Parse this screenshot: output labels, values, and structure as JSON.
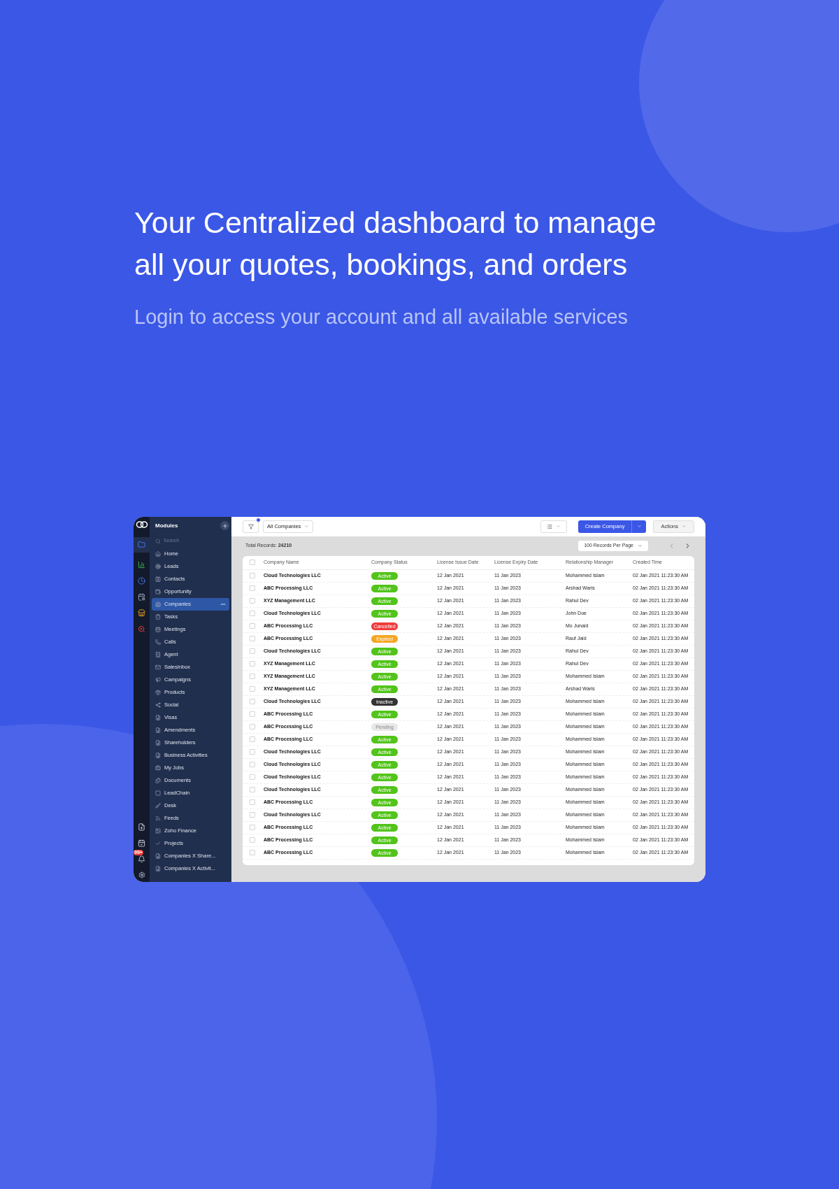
{
  "hero": {
    "title_lines": [
      "Your Centralized dashboard to manage",
      "all your quotes, bookings, and orders"
    ],
    "subtitle": "Login to access your account and all available services"
  },
  "app": {
    "rail": {
      "notification_badge": "99+"
    },
    "sidebar": {
      "title": "Modules",
      "search": {
        "placeholder": "Search"
      },
      "items": [
        {
          "label": "Home",
          "selected": false
        },
        {
          "label": "Leads",
          "selected": false
        },
        {
          "label": "Contacts",
          "selected": false
        },
        {
          "label": "Opportunity",
          "selected": false
        },
        {
          "label": "Companies",
          "selected": true
        },
        {
          "label": "Tasks",
          "selected": false
        },
        {
          "label": "Meetings",
          "selected": false
        },
        {
          "label": "Calls",
          "selected": false
        },
        {
          "label": "Agent",
          "selected": false
        },
        {
          "label": "SalesInbox",
          "selected": false
        },
        {
          "label": "Campaigns",
          "selected": false
        },
        {
          "label": "Products",
          "selected": false
        },
        {
          "label": "Social",
          "selected": false
        },
        {
          "label": "Visas",
          "selected": false
        },
        {
          "label": "Amendments",
          "selected": false
        },
        {
          "label": "Shareholders",
          "selected": false
        },
        {
          "label": "Business Activities",
          "selected": false
        },
        {
          "label": "My Jobs",
          "selected": false
        },
        {
          "label": "Documents",
          "selected": false
        },
        {
          "label": "LeadChain",
          "selected": false
        },
        {
          "label": "Desk",
          "selected": false
        },
        {
          "label": "Feeds",
          "selected": false
        },
        {
          "label": "Zoho Finance",
          "selected": false
        },
        {
          "label": "Projects",
          "selected": false
        },
        {
          "label": "Companies X Share...",
          "selected": false
        },
        {
          "label": "Companies X Activit...",
          "selected": false
        }
      ]
    },
    "toolbar": {
      "view": "All Companies",
      "create_button": "Create Company",
      "actions_button": "Actions"
    },
    "summary": {
      "label": "Total Records:",
      "count": "24210"
    },
    "per_page": "100 Records Per Page",
    "table": {
      "all_checked": false,
      "columns": [
        "Company Name",
        "Company Status",
        "License Issue Date",
        "License Expiry Date",
        "Relationship Manager",
        "Created Time"
      ],
      "rows": [
        {
          "checked": false,
          "name": "Cloud Technologies LLC",
          "status": {
            "label": "Active",
            "kind": "active"
          },
          "issue": "12 Jan 2021",
          "expiry": "11 Jan 2023",
          "manager": "Mohammed Islam",
          "created": "02 Jan 2021 11:23:30 AM"
        },
        {
          "checked": false,
          "name": "ABC Processing LLC",
          "status": {
            "label": "Active",
            "kind": "active"
          },
          "issue": "12 Jan 2021",
          "expiry": "11 Jan 2023",
          "manager": "Arshad Waris",
          "created": "02 Jan 2021 11:23:30 AM"
        },
        {
          "checked": false,
          "name": "XYZ Management LLC",
          "status": {
            "label": "Active",
            "kind": "active"
          },
          "issue": "12 Jan 2021",
          "expiry": "11 Jan 2023",
          "manager": "Rahul Dev",
          "created": "02 Jan 2021 11:23:30 AM"
        },
        {
          "checked": false,
          "name": "Cloud Technologies LLC",
          "status": {
            "label": "Active",
            "kind": "active"
          },
          "issue": "12 Jan 2021",
          "expiry": "11 Jan 2023",
          "manager": "John Doe",
          "created": "02 Jan 2021 11:23:30 AM"
        },
        {
          "checked": false,
          "name": "ABC Processing LLC",
          "status": {
            "label": "Cancelled",
            "kind": "cancelled"
          },
          "issue": "12 Jan 2021",
          "expiry": "11 Jan 2023",
          "manager": "Mo Junaid",
          "created": "02 Jan 2021 11:23:30 AM"
        },
        {
          "checked": false,
          "name": "ABC Processing LLC",
          "status": {
            "label": "Expired",
            "kind": "expired"
          },
          "issue": "12 Jan 2021",
          "expiry": "11 Jan 2023",
          "manager": "Rauf Jaid",
          "created": "02 Jan 2021 11:23:30 AM"
        },
        {
          "checked": false,
          "name": "Cloud Technologies LLC",
          "status": {
            "label": "Active",
            "kind": "active"
          },
          "issue": "12 Jan 2021",
          "expiry": "11 Jan 2023",
          "manager": "Rahul Dev",
          "created": "02 Jan 2021 11:23:30 AM"
        },
        {
          "checked": false,
          "name": "XYZ Management LLC",
          "status": {
            "label": "Active",
            "kind": "active"
          },
          "issue": "12 Jan 2021",
          "expiry": "11 Jan 2023",
          "manager": "Rahul Dev",
          "created": "02 Jan 2021 11:23:30 AM"
        },
        {
          "checked": false,
          "name": "XYZ Management LLC",
          "status": {
            "label": "Active",
            "kind": "active"
          },
          "issue": "12 Jan 2021",
          "expiry": "11 Jan 2023",
          "manager": "Mohammed Islam",
          "created": "02 Jan 2021 11:23:30 AM"
        },
        {
          "checked": false,
          "name": "XYZ Management LLC",
          "status": {
            "label": "Active",
            "kind": "active"
          },
          "issue": "12 Jan 2021",
          "expiry": "11 Jan 2023",
          "manager": "Arshad Waris",
          "created": "02 Jan 2021 11:23:30 AM"
        },
        {
          "checked": false,
          "name": "Cloud Technologies LLC",
          "status": {
            "label": "Inactive",
            "kind": "inactive"
          },
          "issue": "12 Jan 2021",
          "expiry": "11 Jan 2023",
          "manager": "Mohammed Islam",
          "created": "02 Jan 2021 11:23:30 AM"
        },
        {
          "checked": false,
          "name": "ABC Processing LLC",
          "status": {
            "label": "Active",
            "kind": "active"
          },
          "issue": "12 Jan 2021",
          "expiry": "11 Jan 2023",
          "manager": "Mohammed Islam",
          "created": "02 Jan 2021 11:23:30 AM"
        },
        {
          "checked": false,
          "name": "ABC Processing LLC",
          "status": {
            "label": "Pending",
            "kind": "pending"
          },
          "issue": "12 Jan 2021",
          "expiry": "11 Jan 2023",
          "manager": "Mohammed Islam",
          "created": "02 Jan 2021 11:23:30 AM"
        },
        {
          "checked": false,
          "name": "ABC Processing LLC",
          "status": {
            "label": "Active",
            "kind": "active"
          },
          "issue": "12 Jan 2021",
          "expiry": "11 Jan 2023",
          "manager": "Mohammed Islam",
          "created": "02 Jan 2021 11:23:30 AM"
        },
        {
          "checked": false,
          "name": "Cloud Technologies LLC",
          "status": {
            "label": "Active",
            "kind": "active"
          },
          "issue": "12 Jan 2021",
          "expiry": "11 Jan 2023",
          "manager": "Mohammed Islam",
          "created": "02 Jan 2021 11:23:30 AM"
        },
        {
          "checked": false,
          "name": "Cloud Technologies LLC",
          "status": {
            "label": "Active",
            "kind": "active"
          },
          "issue": "12 Jan 2021",
          "expiry": "11 Jan 2023",
          "manager": "Mohammed Islam",
          "created": "02 Jan 2021 11:23:30 AM"
        },
        {
          "checked": false,
          "name": "Cloud Technologies LLC",
          "status": {
            "label": "Active",
            "kind": "active"
          },
          "issue": "12 Jan 2021",
          "expiry": "11 Jan 2023",
          "manager": "Mohammed Islam",
          "created": "02 Jan 2021 11:23:30 AM"
        },
        {
          "checked": false,
          "name": "Cloud Technologies LLC",
          "status": {
            "label": "Active",
            "kind": "active"
          },
          "issue": "12 Jan 2021",
          "expiry": "11 Jan 2023",
          "manager": "Mohammed Islam",
          "created": "02 Jan 2021 11:23:30 AM"
        },
        {
          "checked": false,
          "name": "ABC Processing LLC",
          "status": {
            "label": "Active",
            "kind": "active"
          },
          "issue": "12 Jan 2021",
          "expiry": "11 Jan 2023",
          "manager": "Mohammed Islam",
          "created": "02 Jan 2021 11:23:30 AM"
        },
        {
          "checked": false,
          "name": "Cloud Technologies LLC",
          "status": {
            "label": "Active",
            "kind": "active"
          },
          "issue": "12 Jan 2021",
          "expiry": "11 Jan 2023",
          "manager": "Mohammed Islam",
          "created": "02 Jan 2021 11:23:30 AM"
        },
        {
          "checked": false,
          "name": "ABC Processing LLC",
          "status": {
            "label": "Active",
            "kind": "active"
          },
          "issue": "12 Jan 2021",
          "expiry": "11 Jan 2023",
          "manager": "Mohammed Islam",
          "created": "02 Jan 2021 11:23:30 AM"
        },
        {
          "checked": false,
          "name": "ABC Processing LLC",
          "status": {
            "label": "Active",
            "kind": "active"
          },
          "issue": "12 Jan 2021",
          "expiry": "11 Jan 2023",
          "manager": "Mohammed Islam",
          "created": "02 Jan 2021 11:23:30 AM"
        },
        {
          "checked": false,
          "name": "ABC Processing LLC",
          "status": {
            "label": "Active",
            "kind": "active"
          },
          "issue": "12 Jan 2021",
          "expiry": "11 Jan 2023",
          "manager": "Mohammed Islam",
          "created": "02 Jan 2021 11:23:30 AM"
        }
      ]
    }
  }
}
